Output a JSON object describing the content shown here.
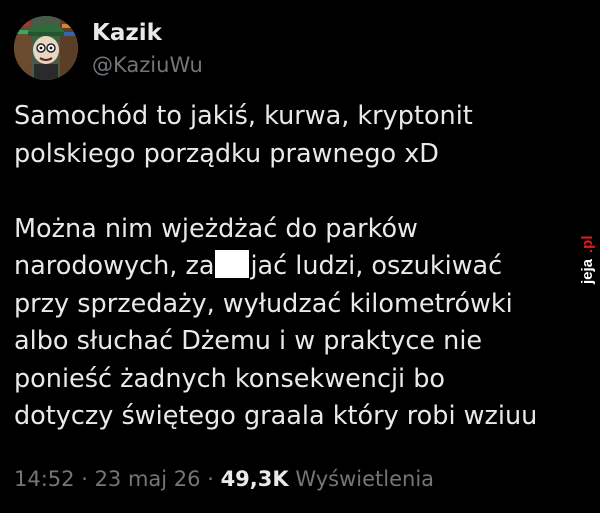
{
  "author": {
    "display_name": "Kazik",
    "handle": "@KaziuWu"
  },
  "tweet": {
    "para1_line1": "Samochód to jakiś, kurwa, kryptonit",
    "para1_line2": "polskiego porządku prawnego xD",
    "para2_line1": "Można nim wjeżdżać do parków",
    "para2_line2_a": "narodowych, za",
    "para2_line2_b": "jać ludzi, oszukiwać",
    "para2_line3": "przy sprzedaży, wyłudzać kilometrówki",
    "para2_line4": "albo słuchać Dżemu i w praktyce nie",
    "para2_line5": "ponieść żadnych konsekwencji bo",
    "para2_line6": "dotyczy świętego graala który robi wziuu"
  },
  "meta": {
    "time": "14:52",
    "sep1": " · ",
    "date": "23 maj 26",
    "sep2": " · ",
    "views_count": "49,3K",
    "views_label": " Wyświetlenia"
  },
  "watermark": {
    "text": "jeja.pl",
    "colors": {
      "white": "#ffffff",
      "red": "#e21b1b"
    }
  }
}
